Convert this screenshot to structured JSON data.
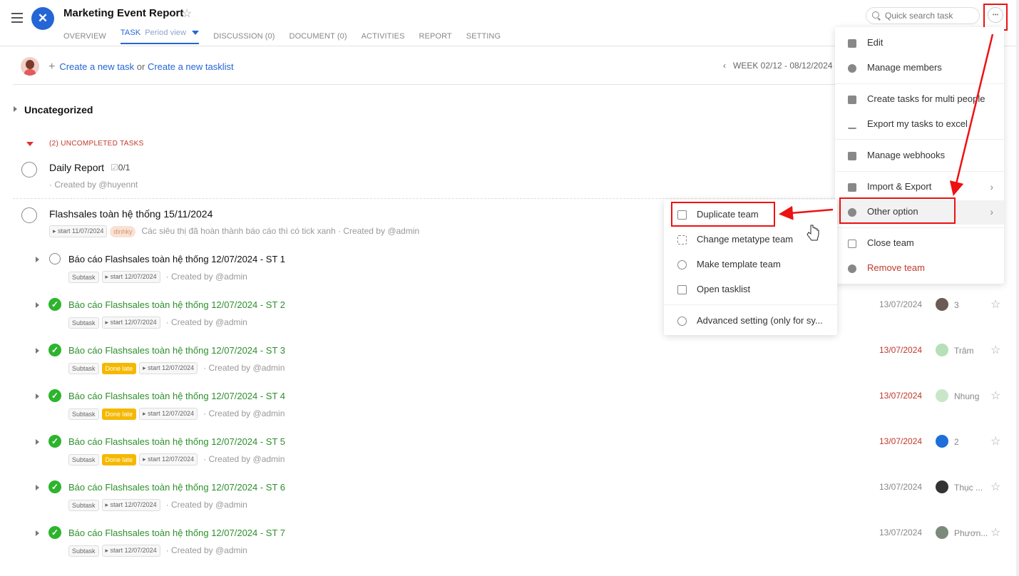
{
  "header": {
    "title": "Marketing Event Report",
    "tabs": [
      {
        "label": "OVERVIEW"
      },
      {
        "label": "TASK",
        "sub": "Period view"
      },
      {
        "label": "DISCUSSION (0)"
      },
      {
        "label": "DOCUMENT (0)"
      },
      {
        "label": "ACTIVITIES"
      },
      {
        "label": "REPORT"
      },
      {
        "label": "SETTING"
      }
    ],
    "search_placeholder": "Quick search task"
  },
  "toolbar": {
    "create_task": "Create a new task",
    "or": "or",
    "create_tasklist": "Create a new tasklist",
    "week": "WEEK 02/12 - 08/12/2024"
  },
  "section": {
    "title": "Uncategorized",
    "uncompleted": "(2) UNCOMPLETED TASKS"
  },
  "tasks": [
    {
      "name": "Daily Report",
      "checklist": "0/1",
      "meta": "· Created by @huyennt"
    },
    {
      "name": "Flashsales toàn hệ thống 15/11/2024",
      "start": "start 11/07/2024",
      "tag": "dinhky",
      "meta": "Các siêu thị đã hoàn thành báo cáo thì có tick xanh · Created by @admin"
    }
  ],
  "subtasks": [
    {
      "name": "Báo cáo Flashsales toàn hệ thống 12/07/2024 - ST 1",
      "done": false,
      "late": false,
      "start": "start 12/07/2024",
      "meta": "· Created by @admin",
      "date": "",
      "assignee": ""
    },
    {
      "name": "Báo cáo Flashsales toàn hệ thống 12/07/2024 - ST 2",
      "done": true,
      "late": false,
      "start": "start 12/07/2024",
      "meta": "· Created by @admin",
      "date": "13/07/2024",
      "assignee": "3"
    },
    {
      "name": "Báo cáo Flashsales toàn hệ thống 12/07/2024 - ST 3",
      "done": true,
      "late": true,
      "start": "start 12/07/2024",
      "meta": "· Created by @admin",
      "date": "13/07/2024",
      "assignee": "Trâm"
    },
    {
      "name": "Báo cáo Flashsales toàn hệ thống 12/07/2024 - ST 4",
      "done": true,
      "late": true,
      "start": "start 12/07/2024",
      "meta": "· Created by @admin",
      "date": "13/07/2024",
      "assignee": "Nhung"
    },
    {
      "name": "Báo cáo Flashsales toàn hệ thống 12/07/2024 - ST 5",
      "done": true,
      "late": true,
      "start": "start 12/07/2024",
      "meta": "· Created by @admin",
      "date": "13/07/2024",
      "assignee": "2"
    },
    {
      "name": "Báo cáo Flashsales toàn hệ thống 12/07/2024 - ST 6",
      "done": true,
      "late": false,
      "start": "start 12/07/2024",
      "meta": "· Created by @admin",
      "date": "13/07/2024",
      "assignee": "Thục ..."
    },
    {
      "name": "Báo cáo Flashsales toàn hệ thống 12/07/2024 - ST 7",
      "done": true,
      "late": false,
      "start": "start 12/07/2024",
      "meta": "· Created by @admin",
      "date": "13/07/2024",
      "assignee": "Phươn..."
    }
  ],
  "labels": {
    "subtask": "Subtask",
    "done_late": "Done late"
  },
  "menu": {
    "items": [
      {
        "label": "Edit"
      },
      {
        "label": "Manage members"
      },
      {
        "label": "Create tasks for multi people"
      },
      {
        "label": "Export my tasks to excel"
      },
      {
        "label": "Manage webhooks"
      },
      {
        "label": "Import & Export"
      },
      {
        "label": "Other option"
      },
      {
        "label": "Close team"
      },
      {
        "label": "Remove team"
      }
    ]
  },
  "submenu": {
    "items": [
      {
        "label": "Duplicate team"
      },
      {
        "label": "Change metatype team"
      },
      {
        "label": "Make template team"
      },
      {
        "label": "Open tasklist"
      },
      {
        "label": "Advanced setting (only for sy..."
      }
    ]
  },
  "colors": {
    "accent": "#2566d6",
    "done": "#2db42d",
    "late": "#c0392b",
    "annotation": "#e11111"
  }
}
